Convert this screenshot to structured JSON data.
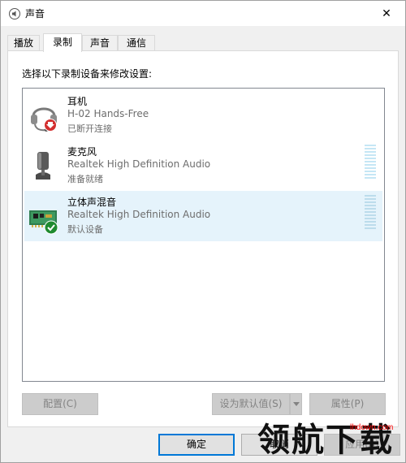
{
  "window": {
    "title": "声音",
    "close_glyph": "✕"
  },
  "tabs": [
    {
      "label": "播放"
    },
    {
      "label": "录制"
    },
    {
      "label": "声音"
    },
    {
      "label": "通信"
    }
  ],
  "instruction": "选择以下录制设备来修改设置:",
  "devices": [
    {
      "name": "耳机",
      "description": "H-02 Hands-Free",
      "status": "已断开连接",
      "icon": "headset-icon",
      "badge": "down-arrow-badge"
    },
    {
      "name": "麦克风",
      "description": "Realtek High Definition Audio",
      "status": "准备就绪",
      "icon": "microphone-icon"
    },
    {
      "name": "立体声混音",
      "description": "Realtek High Definition Audio",
      "status": "默认设备",
      "icon": "sound-card-icon",
      "badge": "check-badge"
    }
  ],
  "buttons": {
    "configure": "配置(C)",
    "set_default": "设为默认值(S)",
    "properties": "属性(P)",
    "ok": "确定",
    "cancel": "取消",
    "apply": "应用(A)"
  },
  "watermark": {
    "text": "领航下载",
    "url": "lhdown.com"
  },
  "colors": {
    "selection": "#e5f3fb",
    "focus_border": "#0078d7",
    "meter": "#c5e6f5",
    "badge_red": "#d32f2f",
    "badge_green": "#1e8a2f"
  }
}
